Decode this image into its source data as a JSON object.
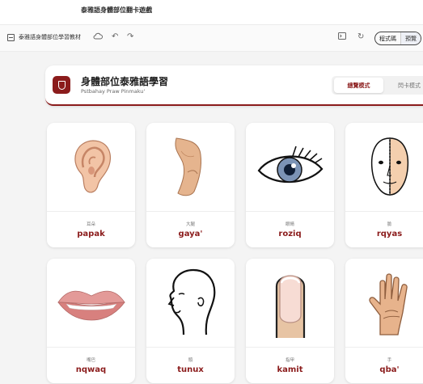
{
  "document": {
    "title": "泰雅語身體部位翻卡遊戲"
  },
  "toolbar": {
    "file_name": "泰雅語身體部位學習教材",
    "code_label": "程式碼",
    "preview_label": "預覽",
    "icons": [
      "file-icon",
      "cloud-icon",
      "undo-icon",
      "redo-icon",
      "terminal-icon",
      "refresh-icon"
    ]
  },
  "header": {
    "title": "身體部位泰雅語學習",
    "subtitle": "Pstbahay Praw Pinmaku'",
    "modes": {
      "overview": "總覽模式",
      "flashcard": "閃卡模式"
    },
    "accent_color": "#8b1c1c"
  },
  "cards": [
    {
      "zh": "耳朵",
      "word": "papak",
      "icon": "ear-icon"
    },
    {
      "zh": "大腿",
      "word": "gaya'",
      "icon": "thigh-icon"
    },
    {
      "zh": "眼睛",
      "word": "roziq",
      "icon": "eye-icon"
    },
    {
      "zh": "臉",
      "word": "rqyas",
      "icon": "face-icon"
    },
    {
      "zh": "嘴巴",
      "word": "nqwaq",
      "icon": "lips-icon"
    },
    {
      "zh": "頭",
      "word": "tunux",
      "icon": "head-icon"
    },
    {
      "zh": "指甲",
      "word": "kamit",
      "icon": "fingernail-icon"
    },
    {
      "zh": "手",
      "word": "qba'",
      "icon": "hand-icon"
    }
  ]
}
